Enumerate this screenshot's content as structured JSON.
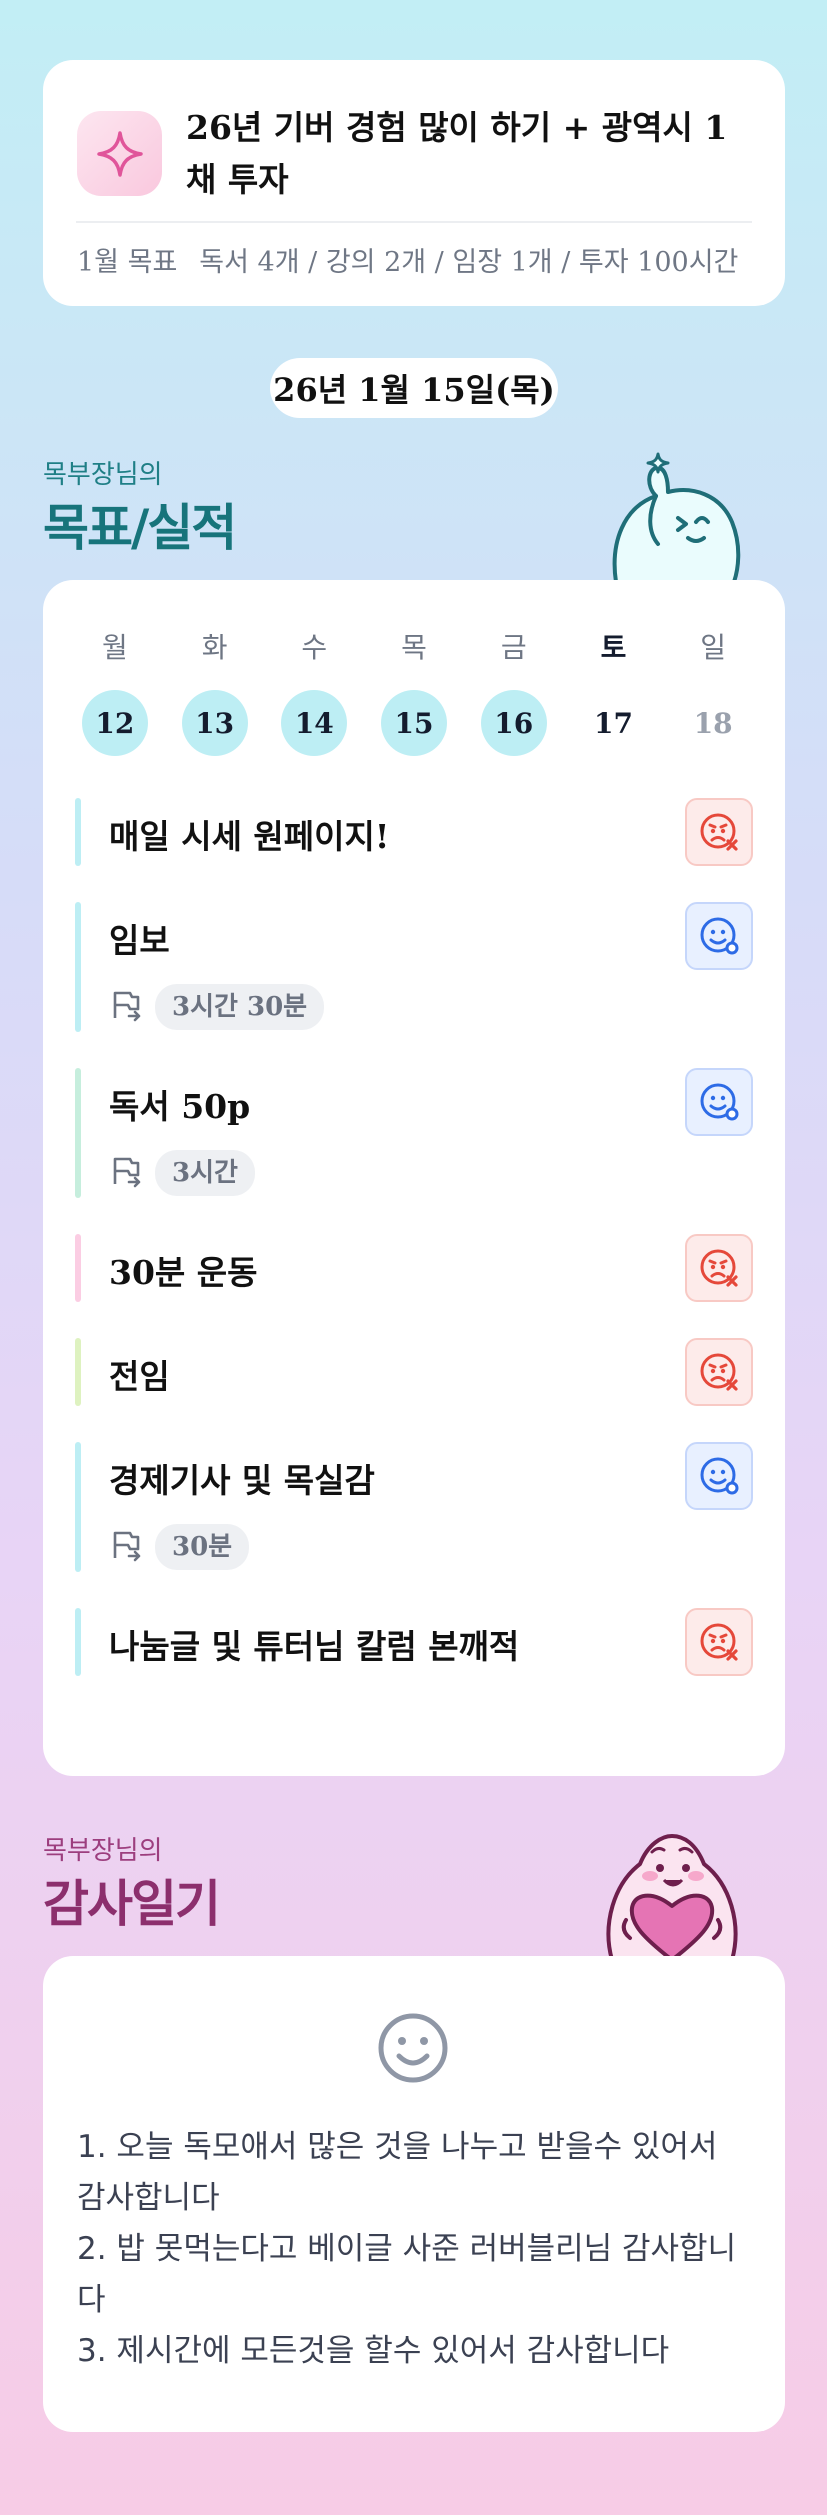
{
  "goal": {
    "title": "26년 기버 경험 많이 하기 + 광역시 1채 투자",
    "sub_label": "1월 목표",
    "sub_text": "독서 4개 / 강의 2개 / 임장 1개 / 투자 100시간",
    "icon": "sparkle-icon"
  },
  "date": "26년 1월 15일(목)",
  "goal_section": {
    "small": "목부장님의",
    "big": "목표/실적",
    "mascot": "waving-character"
  },
  "week": {
    "days": [
      {
        "label": "월",
        "date": "12",
        "state": "done"
      },
      {
        "label": "화",
        "date": "13",
        "state": "done"
      },
      {
        "label": "수",
        "date": "14",
        "state": "done"
      },
      {
        "label": "목",
        "date": "15",
        "state": "done"
      },
      {
        "label": "금",
        "date": "16",
        "state": "done"
      },
      {
        "label": "토",
        "date": "17",
        "state": "today"
      },
      {
        "label": "일",
        "date": "18",
        "state": "future"
      }
    ]
  },
  "tasks": [
    {
      "name": "매일 시세 원페이지!",
      "status": "fail",
      "duration": "",
      "color": "#bdeef4"
    },
    {
      "name": "임보",
      "status": "ok",
      "duration": "3시간 30분",
      "color": "#bdeef4"
    },
    {
      "name": "독서 50p",
      "status": "ok",
      "duration": "3시간",
      "color": "#c6eedd"
    },
    {
      "name": "30분 운동",
      "status": "fail",
      "duration": "",
      "color": "#fbcde3"
    },
    {
      "name": "전임",
      "status": "fail",
      "duration": "",
      "color": "#def2c0"
    },
    {
      "name": "경제기사 및 목실감",
      "status": "ok",
      "duration": "30분",
      "color": "#bdeef4"
    },
    {
      "name": "나눔글 및 튜터님 칼럼 본깨적",
      "status": "fail",
      "duration": "",
      "color": "#bdeef4"
    }
  ],
  "thanks_section": {
    "small": "목부장님의",
    "big": "감사일기",
    "mascot": "heart-hugging-character"
  },
  "thanks": {
    "icon": "smile-icon",
    "lines": [
      "1. 오늘 독모애서 많은 것을 나누고 받을수 있어서 감사합니다",
      "2. 밥 못먹는다고 베이글 사준 러버블리님 감사합니다",
      "3. 제시간에 모든것을 할수 있어서 감사합니다"
    ]
  },
  "colors": {
    "fail": "#e5483a",
    "ok": "#2d6be6",
    "done_circle": "#bdeef4"
  }
}
